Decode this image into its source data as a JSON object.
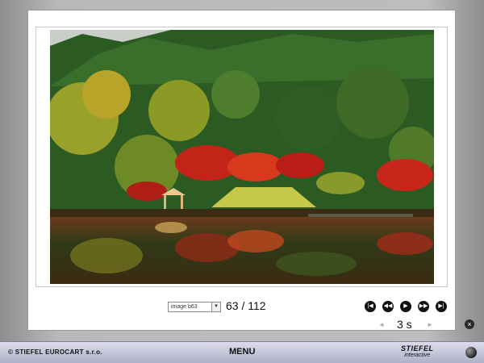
{
  "viewer": {
    "image_select": {
      "selected": "image b63"
    },
    "counter": "63 / 112",
    "nav": {
      "first_icon": "skip-first-icon",
      "prev_icon": "previous-icon",
      "play_icon": "play-icon",
      "next_icon": "next-icon",
      "last_icon": "skip-last-icon"
    },
    "delay": {
      "value": "3 s",
      "decrease": "◄",
      "increase": "►"
    }
  },
  "close_icon": "close-icon",
  "footer": {
    "copyright": "© STIEFEL EUROCART s.r.o.",
    "menu": "MENU",
    "brand_line1": "STIEFEL",
    "brand_line2": "interactive",
    "globe_icon": "globe-icon"
  },
  "colors": {
    "footer_bg": "#c4c6dc",
    "viewer_bg": "#ffffff",
    "frame_bg": "#b5b5b5"
  }
}
